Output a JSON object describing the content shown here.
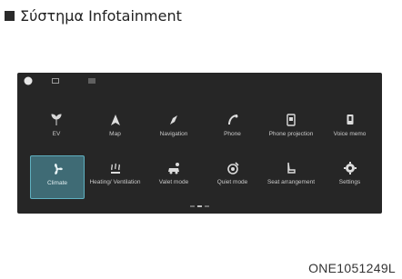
{
  "header": {
    "title": "Σύστημα Infotainment"
  },
  "screen": {
    "menu_tiles": [
      {
        "label": "EV",
        "icon": "leaf-icon",
        "selected": false
      },
      {
        "label": "Map",
        "icon": "navigation-arrow-icon",
        "selected": false
      },
      {
        "label": "Navigation",
        "icon": "compass-icon",
        "selected": false
      },
      {
        "label": "Phone",
        "icon": "phone-icon",
        "selected": false
      },
      {
        "label": "Phone projection",
        "icon": "phone-projection-icon",
        "selected": false
      },
      {
        "label": "Voice memo",
        "icon": "voice-memo-icon",
        "selected": false
      },
      {
        "label": "Climate",
        "icon": "fan-icon",
        "selected": true
      },
      {
        "label": "Heating/ Ventilation",
        "icon": "seat-heating-icon",
        "selected": false
      },
      {
        "label": "Valet mode",
        "icon": "valet-car-icon",
        "selected": false
      },
      {
        "label": "Quiet mode",
        "icon": "quiet-mode-icon",
        "selected": false
      },
      {
        "label": "Seat arrangement",
        "icon": "seat-icon",
        "selected": false
      },
      {
        "label": "Settings",
        "icon": "gear-icon",
        "selected": false
      }
    ],
    "page_indicator": {
      "pages": 3,
      "current": 2
    }
  },
  "figure_code": "ONE1051249L",
  "colors": {
    "screen_bg": "#262626",
    "selected_tile": "#3f6b75",
    "selected_border": "#5fb0c0",
    "label": "#c9c9c9"
  }
}
